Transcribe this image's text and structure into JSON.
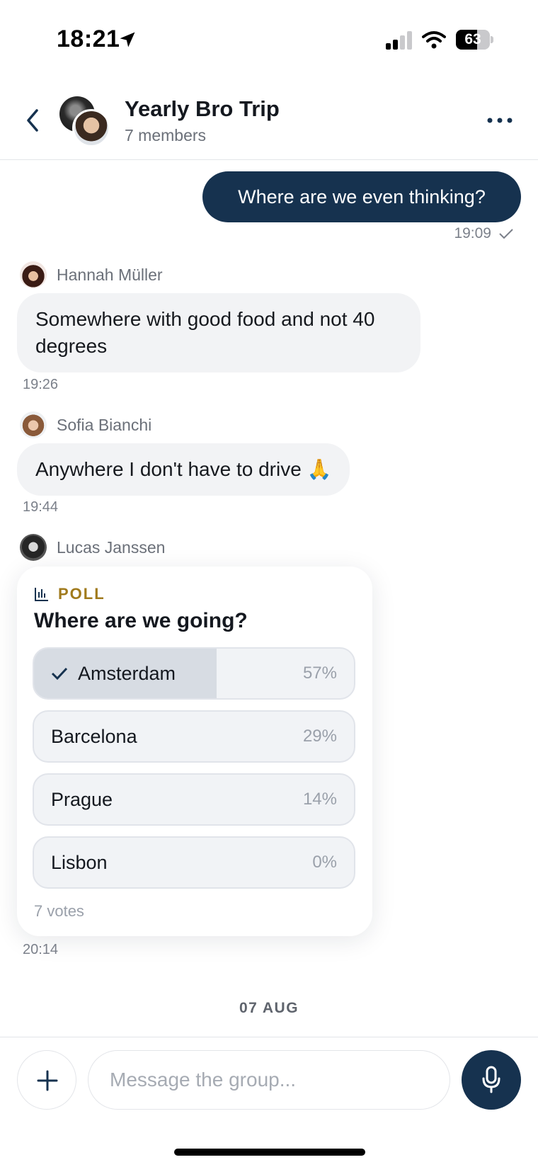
{
  "status_bar": {
    "time": "18:21",
    "battery_percent": "63",
    "battery_level": 0.63,
    "icons": [
      "location-arrow-icon",
      "cellular-signal-icon",
      "wifi-icon",
      "battery-icon"
    ]
  },
  "header": {
    "title": "Yearly Bro Trip",
    "subtitle": "7 members",
    "icons": [
      "back-chevron-icon",
      "more-dots-icon"
    ]
  },
  "messages": [
    {
      "direction": "outgoing",
      "text": "Where are we even thinking?",
      "time": "19:09",
      "status_icon": "checkmark-icon"
    },
    {
      "direction": "incoming",
      "sender": "Hannah Müller",
      "text": "Somewhere with good food and not 40 degrees",
      "time": "19:26"
    },
    {
      "direction": "incoming",
      "sender": "Sofia Bianchi",
      "text": "Anywhere I don't have to drive 🙏",
      "time": "19:44"
    },
    {
      "direction": "incoming",
      "sender": "Lucas Janssen",
      "time": "20:14"
    }
  ],
  "poll": {
    "tag": "POLL",
    "question": "Where are we going?",
    "options": [
      {
        "label": "Amsterdam",
        "percent": "57%",
        "value": 57,
        "selected": true
      },
      {
        "label": "Barcelona",
        "percent": "29%",
        "value": 29,
        "selected": false
      },
      {
        "label": "Prague",
        "percent": "14%",
        "value": 14,
        "selected": false
      },
      {
        "label": "Lisbon",
        "percent": "0%",
        "value": 0,
        "selected": false
      }
    ],
    "votes": "7 votes"
  },
  "date_separator": "07 AUG",
  "composer": {
    "placeholder": "Message the group...",
    "icons": [
      "plus-icon",
      "microphone-icon"
    ]
  },
  "colors": {
    "primary": "#16324f",
    "incoming_bubble": "#f2f3f5",
    "poll_accent": "#a07a1c"
  }
}
